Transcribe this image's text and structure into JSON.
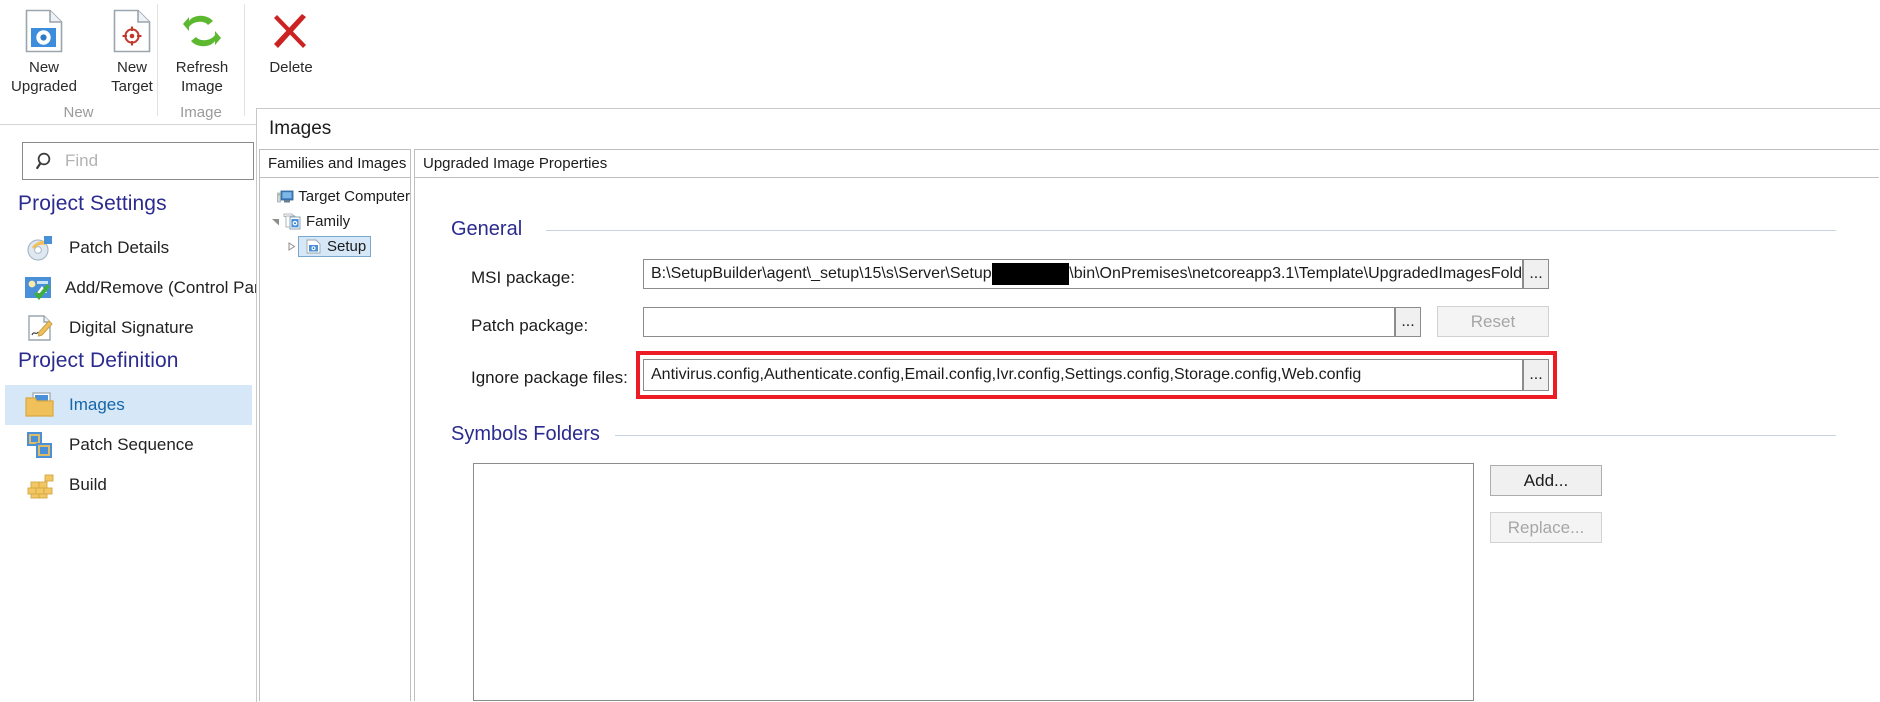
{
  "ribbon": {
    "groups": [
      {
        "label": "New",
        "buttons": [
          {
            "name": "new-upgraded",
            "label": "New\nUpgraded",
            "icon": "document-disc-icon"
          },
          {
            "name": "new-target",
            "label": "New\nTarget",
            "icon": "document-target-icon"
          }
        ]
      },
      {
        "label": "Image",
        "buttons": [
          {
            "name": "refresh-image",
            "label": "Refresh\nImage",
            "icon": "refresh-arrows-icon"
          }
        ]
      },
      {
        "label": "",
        "buttons": [
          {
            "name": "delete",
            "label": "Delete",
            "icon": "red-x-icon"
          }
        ]
      }
    ]
  },
  "sidebar": {
    "find": {
      "placeholder": "Find",
      "value": "",
      "icon": "search-icon"
    },
    "sections": [
      {
        "header": "Project Settings",
        "items": [
          {
            "label": "Patch Details",
            "icon": "patch-disc-icon",
            "selected": false
          },
          {
            "label": "Add/Remove (Control Pane",
            "icon": "add-remove-icon",
            "selected": false
          },
          {
            "label": "Digital Signature",
            "icon": "signature-pen-icon",
            "selected": false
          }
        ]
      },
      {
        "header": "Project Definition",
        "items": [
          {
            "label": "Images",
            "icon": "images-folder-icon",
            "selected": true
          },
          {
            "label": "Patch Sequence",
            "icon": "patch-sequence-icon",
            "selected": false
          },
          {
            "label": "Build",
            "icon": "build-bricks-icon",
            "selected": false
          }
        ]
      }
    ]
  },
  "dialog": {
    "title": "Images",
    "tree_tab": "Families and Images",
    "props_tab": "Upgraded Image Properties",
    "tree": [
      {
        "label": "Target Computer",
        "depth": 0,
        "icon": "computer-icon",
        "twisty": "none",
        "selected": false
      },
      {
        "label": "Family",
        "depth": 1,
        "icon": "family-images-icon",
        "twisty": "expanded",
        "selected": false
      },
      {
        "label": "Setup",
        "depth": 2,
        "icon": "image-doc-icon",
        "twisty": "collapsed",
        "selected": true
      }
    ],
    "general": {
      "title": "General",
      "msi_package": {
        "label": "MSI package:",
        "value_prefix": "B:\\SetupBuilder\\agent\\_setup\\15\\s\\Server\\Setup",
        "value_suffix": "\\bin\\OnPremises\\netcoreapp3.1\\Template\\UpgradedImagesFold",
        "redacted": true,
        "browse_label": "..."
      },
      "patch_package": {
        "label": "Patch package:",
        "value": "",
        "browse_label": "...",
        "reset_label": "Reset",
        "reset_enabled": false
      },
      "ignore_package_files": {
        "label": "Ignore package files:",
        "value": "Antivirus.config,Authenticate.config,Email.config,Ivr.config,Settings.config,Storage.config,Web.config",
        "browse_label": "...",
        "highlight_color": "#ed1c24"
      }
    },
    "symbols_folders": {
      "title": "Symbols Folders",
      "items": [],
      "add_label": "Add...",
      "replace_label": "Replace...",
      "add_enabled": true,
      "replace_enabled": false
    }
  },
  "colors": {
    "heading": "#2b2b8f",
    "selection": "#d6e8f7",
    "accent_bar": "#7ecbe8",
    "highlight": "#ed1c24",
    "link": "#1565a8"
  }
}
